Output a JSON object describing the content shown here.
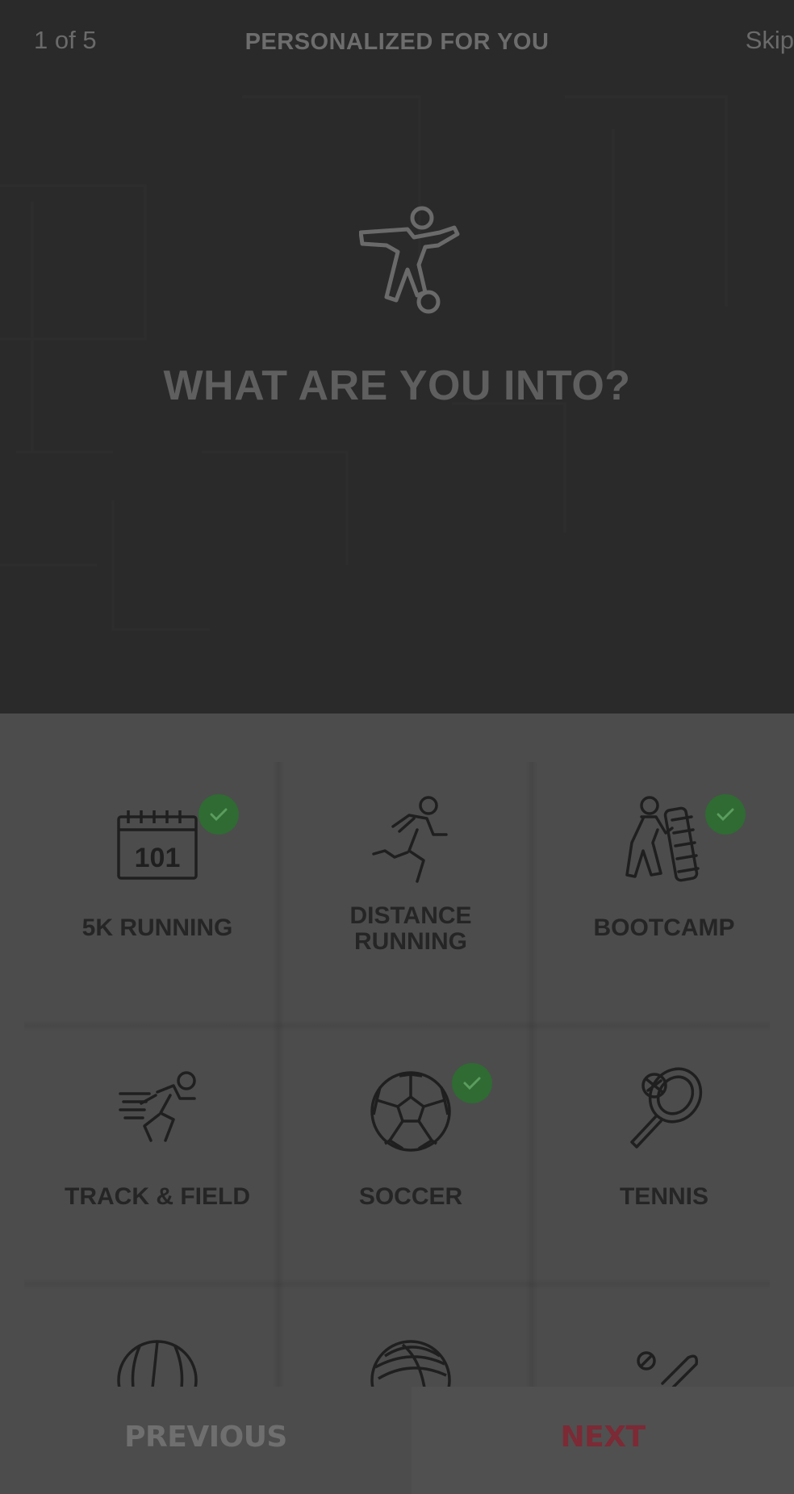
{
  "header": {
    "progress": "1 of 5",
    "title": "PERSONALIZED FOR YOU",
    "skip": "Skip"
  },
  "hero": {
    "icon": "soccer-player-icon",
    "question": "WHAT ARE YOU INTO?"
  },
  "activities": [
    {
      "label": "5K RUNNING",
      "icon": "calendar-101-icon",
      "selected": true
    },
    {
      "label": "DISTANCE RUNNING",
      "icon": "runner-icon",
      "selected": false
    },
    {
      "label": "BOOTCAMP",
      "icon": "tire-flip-icon",
      "selected": true
    },
    {
      "label": "TRACK & FIELD",
      "icon": "sprinter-icon",
      "selected": false
    },
    {
      "label": "SOCCER",
      "icon": "soccer-ball-icon",
      "selected": true
    },
    {
      "label": "TENNIS",
      "icon": "tennis-racket-icon",
      "selected": false
    },
    {
      "label": "",
      "icon": "basketball-icon",
      "selected": false
    },
    {
      "label": "",
      "icon": "volleyball-icon",
      "selected": false
    },
    {
      "label": "",
      "icon": "baseball-icon",
      "selected": false
    }
  ],
  "footer": {
    "previous": "PREVIOUS",
    "next": "NEXT"
  },
  "colors": {
    "selected_check": "#2f6b33",
    "next_accent": "#7c2a35"
  }
}
